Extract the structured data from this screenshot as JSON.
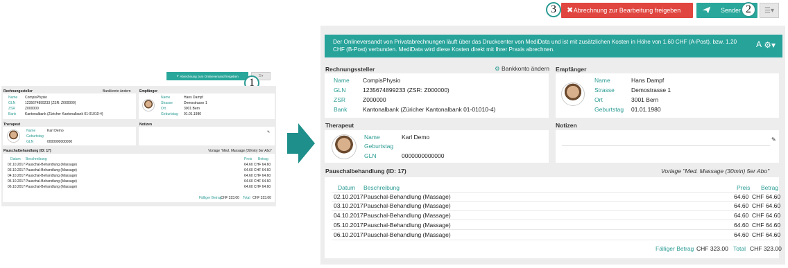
{
  "top": {
    "release_label": "Abrechnung zur Bearbeitung freigeben",
    "send_label": "Senden",
    "markers": [
      "3",
      "2",
      "1"
    ]
  },
  "info": {
    "text": "Der Onlineversandt von Privatabrechnungen läuft über das Druckcenter von MediData und ist mit zusätzlichen Kosten in Höhe von 1.60 CHF (A-Post). bzw. 1.20 CHF (B-Post) verbunden. MediData wird diese Kosten direkt mit Ihrer Praxis abrechnen.",
    "a": "A"
  },
  "biller": {
    "title": "Rechnungssteller",
    "change_bank": "Bankkonto ändern",
    "labels": [
      "Name",
      "GLN",
      "ZSR",
      "Bank"
    ],
    "values": [
      "CompisPhysio",
      "1235674899233 (ZSR: Z000000)",
      "Z000000",
      "Kantonalbank (Züricher Kantonalbank 01-01010-4)"
    ]
  },
  "recipient": {
    "title": "Empfänger",
    "labels": [
      "Name",
      "Strasse",
      "Ort",
      "Geburtstag"
    ],
    "values": [
      "Hans Dampf",
      "Demostrasse 1",
      "3001 Bern",
      "01.01.1980"
    ]
  },
  "therapist": {
    "title": "Therapeut",
    "labels": [
      "Name",
      "Geburtstag",
      "GLN"
    ],
    "values": [
      "Karl Demo",
      "",
      "0000000000000"
    ]
  },
  "notes": {
    "title": "Notizen"
  },
  "flatrate": {
    "title": "Pauschalbehandlung (ID: 17)",
    "template": "Vorlage \"Med. Massage (30min) 5er Abo\"",
    "headers": {
      "date": "Datum",
      "desc": "Beschreibung",
      "price": "Preis",
      "amount": "Betrag"
    },
    "rows": [
      {
        "date": "02.10.2017",
        "desc": "Pauschal-Behandlung (Massage)",
        "price": "64.60",
        "amount": "CHF 64.60"
      },
      {
        "date": "03.10.2017",
        "desc": "Pauschal-Behandlung (Massage)",
        "price": "64.60",
        "amount": "CHF 64.60"
      },
      {
        "date": "04.10.2017",
        "desc": "Pauschal-Behandlung (Massage)",
        "price": "64.60",
        "amount": "CHF 64.60"
      },
      {
        "date": "05.10.2017",
        "desc": "Pauschal-Behandlung (Massage)",
        "price": "64.60",
        "amount": "CHF 64.60"
      },
      {
        "date": "06.10.2017",
        "desc": "Pauschal-Behandlung (Massage)",
        "price": "64.60",
        "amount": "CHF 64.60"
      }
    ],
    "due_label": "Fälliger Betrag",
    "due_value": "CHF 323.00",
    "total_label": "Total",
    "total_value": "CHF 323.00"
  },
  "small": {
    "send_online": "Abrechnung zum Onlineversand freigeben"
  },
  "colors": {
    "accent": "#2a9b93",
    "danger": "#e0453f",
    "info_bg": "#27a39a"
  }
}
